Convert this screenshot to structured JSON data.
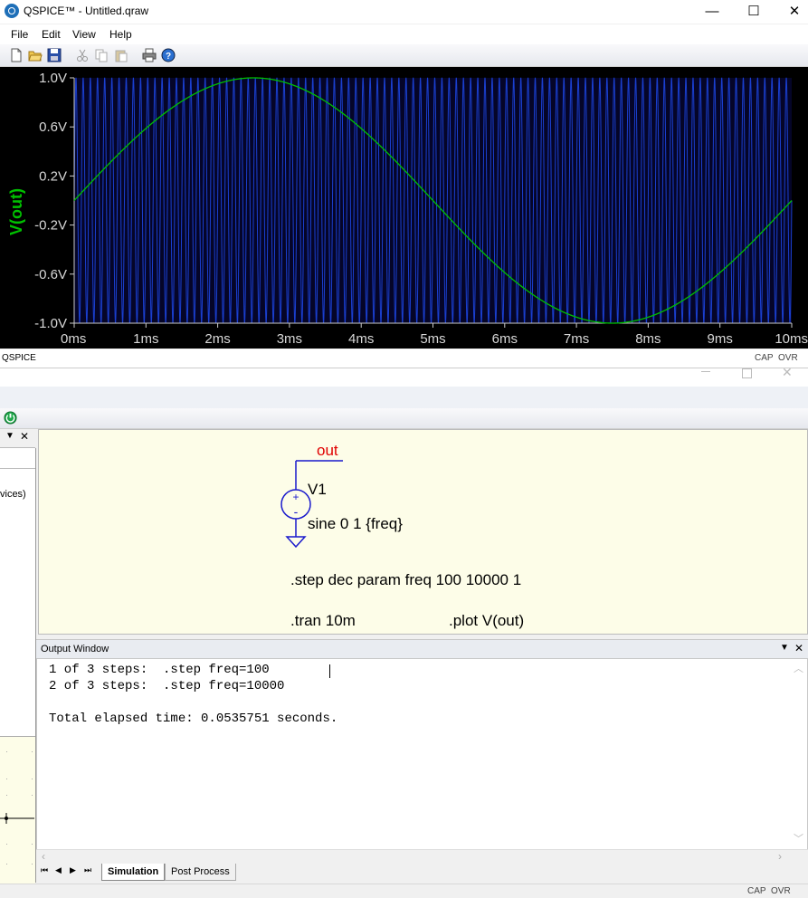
{
  "window": {
    "title": "QSPICE™ - Untitled.qraw",
    "minimize": "—",
    "maximize": "☐",
    "close": "✕"
  },
  "menu": [
    "File",
    "Edit",
    "View",
    "Help"
  ],
  "toolbar": [
    "new-file-icon",
    "open-folder-icon",
    "save-icon",
    "cut-icon",
    "copy-icon",
    "paste-icon",
    "print-icon",
    "help-icon"
  ],
  "waveform": {
    "trace_name": "V(out)",
    "trace_color": "#00c000",
    "carrier_color": "#1a3fd0",
    "background": "#000000"
  },
  "chart_data": {
    "type": "line",
    "title": "",
    "xlabel": "",
    "ylabel": "V(out)",
    "xlim": [
      0,
      10
    ],
    "ylim": [
      -1.0,
      1.0
    ],
    "x_unit": "ms",
    "x_ticks": [
      "0ms",
      "1ms",
      "2ms",
      "3ms",
      "4ms",
      "5ms",
      "6ms",
      "7ms",
      "8ms",
      "9ms",
      "10ms"
    ],
    "y_ticks": [
      "1.0V",
      "0.6V",
      "0.2V",
      "-0.2V",
      "-0.6V",
      "-1.0V"
    ],
    "y_tick_values": [
      1.0,
      0.6,
      0.2,
      -0.2,
      -0.6,
      -1.0
    ],
    "series": [
      {
        "frequency_hz": 100,
        "amplitude": 1,
        "offset": 0,
        "color": "#00c000"
      },
      {
        "frequency_hz": 10000,
        "amplitude": 1,
        "offset": 0,
        "color": "#1a3fd0"
      }
    ]
  },
  "plot_status": {
    "left": "QSPICE",
    "cap": "CAP",
    "ovr": "OVR"
  },
  "schematic": {
    "net_label": "out",
    "component_ref": "V1",
    "component_value": "sine 0 1 {freq}",
    "directive_step": ".step dec param freq 100 10000 1",
    "directive_tran": ".tran 10m",
    "directive_plot": ".plot V(out)",
    "plus_sign": "+",
    "minus_sign": "-"
  },
  "left_panel": {
    "partial_text": "vices)"
  },
  "output_window": {
    "title": "Output Window",
    "lines": [
      "1 of 3 steps:  .step freq=100",
      "2 of 3 steps:  .step freq=10000",
      "",
      "Total elapsed time: 0.0535751 seconds."
    ]
  },
  "tabs": {
    "nav": [
      "⏮",
      "◀",
      "▶",
      "⏭"
    ],
    "items": [
      "Simulation",
      "Post Process"
    ],
    "active": "Simulation"
  },
  "status2": {
    "cap": "CAP",
    "ovr": "OVR"
  }
}
